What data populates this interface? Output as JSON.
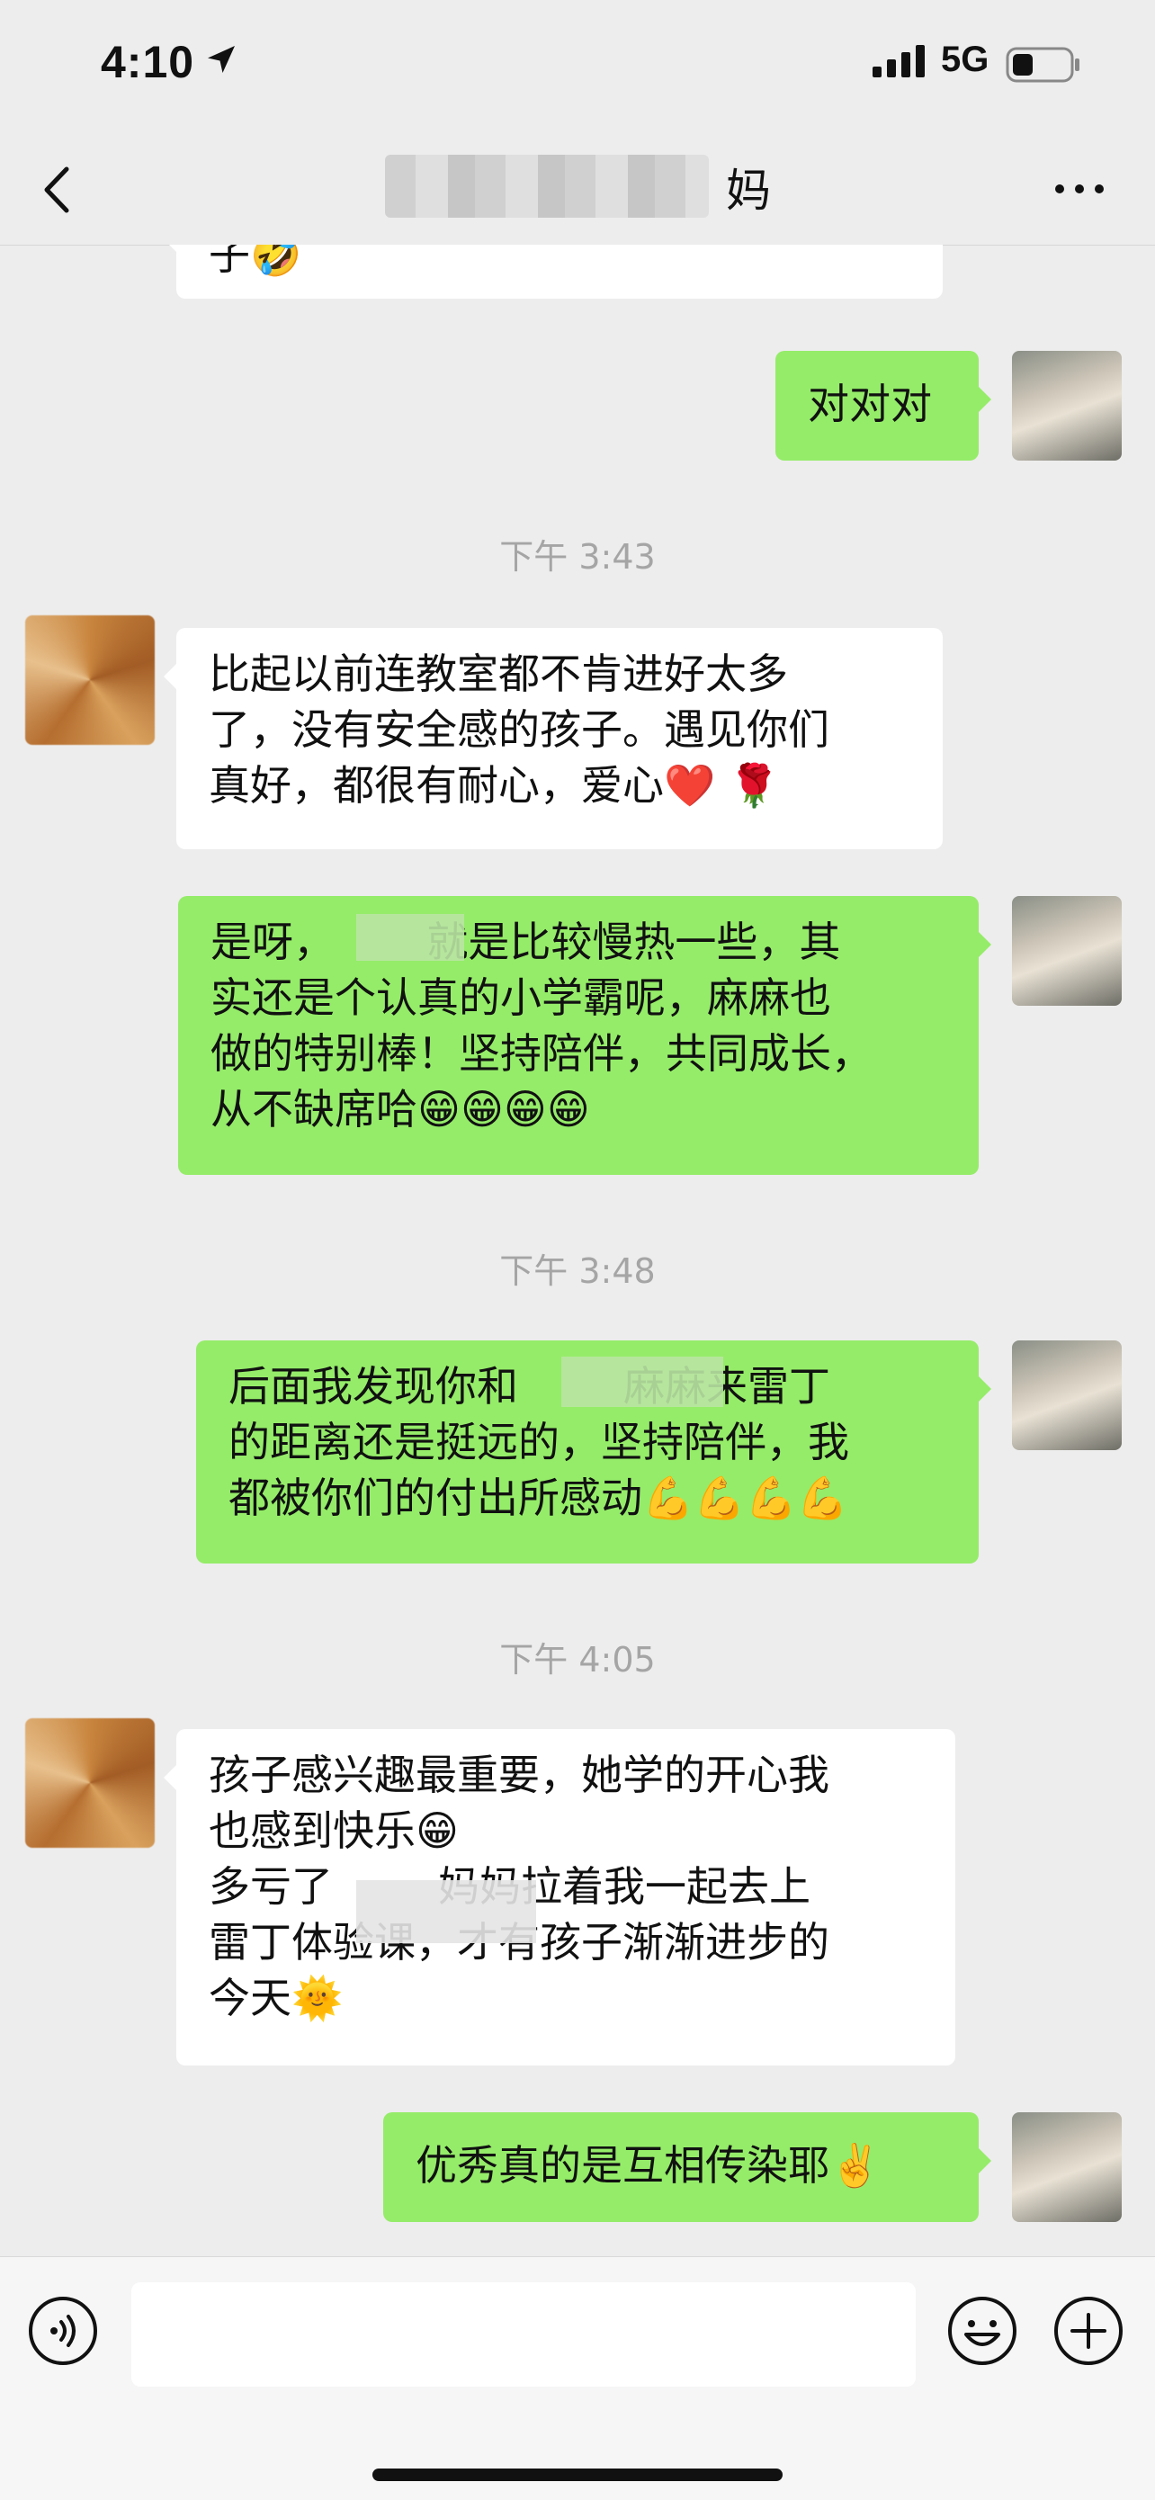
{
  "status_bar": {
    "time": "4:10",
    "network": "5G"
  },
  "nav": {
    "title": "妈",
    "back_icon": "chevron-left-icon",
    "more_icon": "more-dots-icon"
  },
  "messages": [
    {
      "type": "in",
      "text": "子🤣"
    },
    {
      "type": "out",
      "text": "对对对"
    },
    {
      "type": "timestamp",
      "text": "下午 3:43"
    },
    {
      "type": "in",
      "text": "比起以前连教室都不肯进好太多\n了，没有安全感的孩子。遇见你们\n真好，都很有耐心，爱心❤️ 🌹"
    },
    {
      "type": "out",
      "text": "是呀，       就是比较慢热一些，其\n实还是个认真的小学霸呢，麻麻也\n做的特别棒！坚持陪伴，共同成长，\n从不缺席哈😁😁😁😁"
    },
    {
      "type": "timestamp",
      "text": "下午 3:48"
    },
    {
      "type": "out",
      "text": "后面我发现你和        麻麻来雷丁\n的距离还是挺远的，坚持陪伴，我\n都被你们的付出所感动💪💪💪💪"
    },
    {
      "type": "timestamp",
      "text": "下午 4:05"
    },
    {
      "type": "in",
      "text": "孩子感兴趣最重要，她学的开心我\n也感到快乐😁\n多亏了        妈妈拉着我一起去上\n雷丁体验课，才有孩子渐渐进步的\n今天🌞"
    },
    {
      "type": "out",
      "text": "优秀真的是互相传染耶✌️"
    }
  ],
  "input_bar": {
    "voice_icon": "voice-icon",
    "emoji_icon": "emoji-icon",
    "plus_icon": "plus-icon",
    "placeholder": ""
  },
  "colors": {
    "out_bubble": "#95ec69",
    "in_bubble": "#ffffff",
    "background": "#ededed"
  }
}
